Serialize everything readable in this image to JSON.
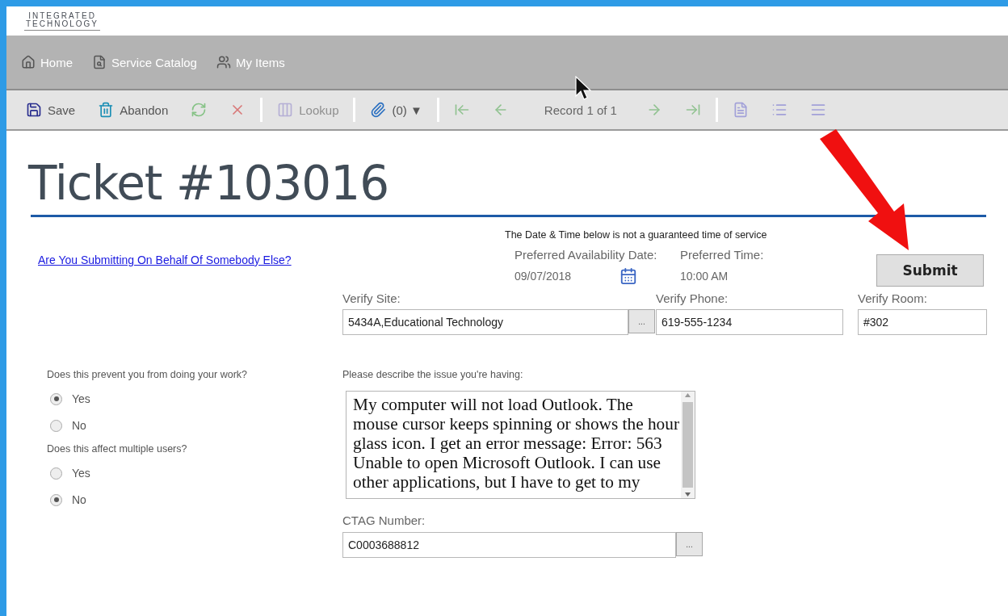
{
  "logo": {
    "line1": "INTEGRATED",
    "line2": "TECHNOLOGY"
  },
  "nav": [
    {
      "label": "Home"
    },
    {
      "label": "Service Catalog"
    },
    {
      "label": "My Items"
    }
  ],
  "toolbar": [
    {
      "kind": "button",
      "label": "Save",
      "disabled": false
    },
    {
      "kind": "button",
      "label": "Abandon",
      "disabled": false
    },
    {
      "kind": "button",
      "disabled": true
    },
    {
      "kind": "button",
      "disabled": true
    },
    {
      "kind": "separator"
    },
    {
      "kind": "button",
      "label": "Lookup",
      "disabled": true
    },
    {
      "kind": "separator"
    },
    {
      "kind": "menu",
      "label": "(0)",
      "caret": "▼"
    },
    {
      "kind": "separator"
    },
    {
      "kind": "button",
      "disabled": true
    },
    {
      "kind": "button",
      "disabled": true
    },
    {
      "kind": "text",
      "label": "Record 1 of 1"
    },
    {
      "kind": "button",
      "disabled": true
    },
    {
      "kind": "button",
      "disabled": true
    },
    {
      "kind": "separator"
    },
    {
      "kind": "button",
      "disabled": true
    },
    {
      "kind": "button",
      "disabled": true
    },
    {
      "kind": "button",
      "disabled": true
    }
  ],
  "title": "Ticket #103016",
  "behalf_link": "Are You Submitting On Behalf Of Somebody Else?",
  "schedule": {
    "note": "The Date & Time below is not a guaranteed time of service",
    "date_label": "Preferred Availability Date:",
    "date_value": "09/07/2018",
    "time_label": "Preferred Time:",
    "time_value": "10:00 AM"
  },
  "submit": "Submit",
  "verify_fields": [
    {
      "label": "Verify Site:",
      "value": "5434A,Educational Technology",
      "lookup_label": "..."
    },
    {
      "label": "Verify Phone:",
      "value": "619-555-1234"
    },
    {
      "label": "Verify Room:",
      "value": "#302"
    }
  ],
  "questions": [
    {
      "label": "Does this prevent you from doing your work?",
      "options": [
        {
          "label": "Yes",
          "selected": true
        },
        {
          "label": "No",
          "selected": false
        }
      ]
    },
    {
      "label": "Does this affect multiple users?",
      "options": [
        {
          "label": "Yes",
          "selected": false
        },
        {
          "label": "No",
          "selected": true
        }
      ]
    }
  ],
  "description": {
    "label": "Please describe the issue you're having:",
    "value": "My computer will not load Outlook. The mouse cursor keeps spinning or shows the hour glass icon. I get an error message: Error: 563 Unable to open Microsoft Outlook. I can use other applications, but I have to get to my"
  },
  "ctag": {
    "label": "CTAG Number:",
    "value": "C0003688812",
    "lookup_label": "..."
  }
}
